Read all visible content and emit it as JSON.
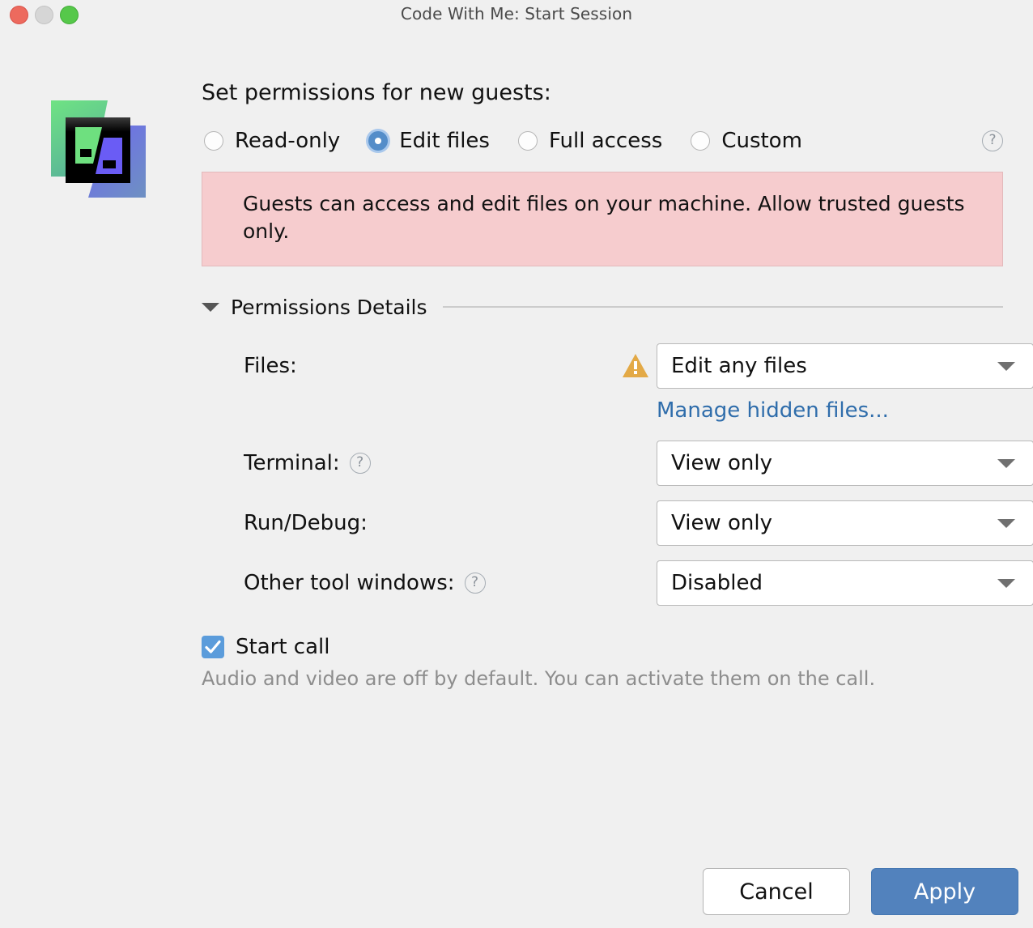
{
  "window": {
    "title": "Code With Me: Start Session",
    "traffic_lights": {
      "close_color": "#ed6a5e",
      "minimize_color": "#d6d6d6",
      "zoom_color": "#56c84a"
    }
  },
  "logo": {
    "name": "code-with-me-logo",
    "green": "#6ee07f",
    "blue": "#6a63f0",
    "black": "#000000"
  },
  "permissions": {
    "heading": "Set permissions for new guests:",
    "help_tooltip_label": "?",
    "options": [
      {
        "label": "Read-only",
        "selected": false
      },
      {
        "label": "Edit files",
        "selected": true
      },
      {
        "label": "Full access",
        "selected": false
      },
      {
        "label": "Custom",
        "selected": false
      }
    ],
    "selected_option": "Edit files",
    "warning": {
      "text": "Guests can access and edit files on your machine. Allow trusted guests only.",
      "background": "#f6ccce",
      "border": "#e3b9bb"
    }
  },
  "details": {
    "title": "Permissions Details",
    "expanded": true,
    "rows": [
      {
        "label": "Files:",
        "has_help": false,
        "has_warning_icon": true,
        "value": "Edit any files",
        "sub_link": "Manage hidden files..."
      },
      {
        "label": "Terminal:",
        "has_help": true,
        "has_warning_icon": false,
        "value": "View only",
        "sub_link": null
      },
      {
        "label": "Run/Debug:",
        "has_help": true,
        "has_warning_icon": false,
        "value": "View only",
        "sub_link": null
      },
      {
        "label": "Other tool windows:",
        "has_help": true,
        "has_warning_icon": false,
        "value": "Disabled",
        "sub_link": null
      }
    ]
  },
  "start_call": {
    "label": "Start call",
    "checked": true,
    "hint": "Audio and video are off by default. You can activate them on the call."
  },
  "footer": {
    "cancel_label": "Cancel",
    "apply_label": "Apply",
    "apply_color": "#5282bd"
  },
  "colors": {
    "window_background": "#f0f0f0",
    "accent_blue": "#5282bd",
    "link_blue": "#2f6dab",
    "warning_amber": "#e3a946",
    "radio_selected": "#548dc9",
    "radio_halo": "#a9c8ec"
  }
}
